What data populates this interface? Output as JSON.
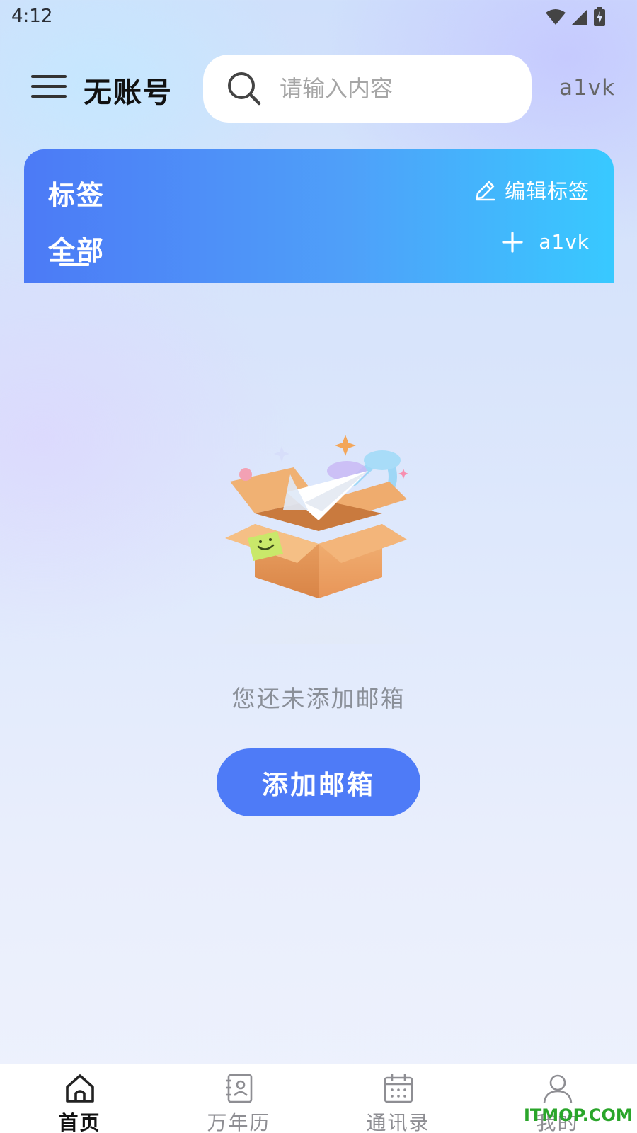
{
  "status_bar": {
    "time": "4:12"
  },
  "header": {
    "title": "无账号",
    "search_placeholder": "请输入内容",
    "user_code": "a1vk"
  },
  "tag_card": {
    "title": "标签",
    "edit_label": "编辑标签",
    "active_tab": "全部",
    "add_account_label": "a1vk"
  },
  "empty_state": {
    "message": "您还未添加邮箱",
    "button_label": "添加邮箱"
  },
  "bottom_nav": {
    "items": [
      {
        "label": "首页",
        "icon": "home-icon",
        "active": true
      },
      {
        "label": "万年历",
        "icon": "contact-book-icon",
        "active": false
      },
      {
        "label": "通讯录",
        "icon": "calendar-icon",
        "active": false
      },
      {
        "label": "我的",
        "icon": "person-icon",
        "active": false
      }
    ]
  },
  "watermark": "ITMOP.COM",
  "colors": {
    "accent": "#4e7bf7",
    "card_gradient_start": "#4c7af6",
    "card_gradient_end": "#38c9ff",
    "watermark": "#2aa52a"
  }
}
